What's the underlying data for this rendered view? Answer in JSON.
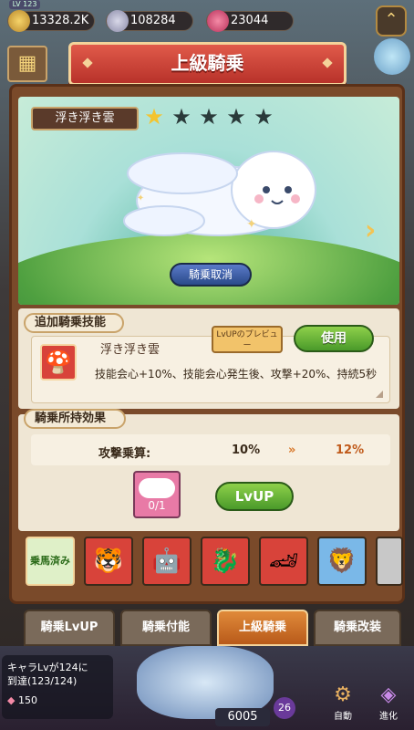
{
  "topbar": {
    "level_tag": "LV 123",
    "gold": "13328.2K",
    "crystal": "108284",
    "gem": "23044"
  },
  "title": "上級騎乗",
  "mount": {
    "name": "浮き浮き雲",
    "stars": 5,
    "stars_filled": 1,
    "dismount_label": "騎乗取消"
  },
  "skill_section": {
    "header": "追加騎乗技能",
    "skill_name": "浮き浮き雲",
    "preview_label": "LvUPのプレビュー",
    "use_label": "使用",
    "description": "技能会心+10%、技能会心発生後、攻撃+20%、持続5秒"
  },
  "effect_section": {
    "header": "騎乗所持効果",
    "stat_label": "攻撃乗算:",
    "current": "10%",
    "next": "12%",
    "material_count": "0/1",
    "lvup_label": "LvUP"
  },
  "mount_list": {
    "riding_label": "乗馬済み"
  },
  "tabs": [
    "騎乗LvUP",
    "騎乗付能",
    "上級騎乗",
    "騎乗改装"
  ],
  "active_tab": 2,
  "bottom": {
    "notice_line1": "キャラLvが124に",
    "notice_line2": "到達(123/124)",
    "notice_cost": "150",
    "power": "6005",
    "badge": "26",
    "auto_label": "自動",
    "evolve_label": "進化"
  },
  "colors": {
    "accent": "#e05a4a",
    "green": "#6ab83a",
    "star": "#f3c430"
  }
}
